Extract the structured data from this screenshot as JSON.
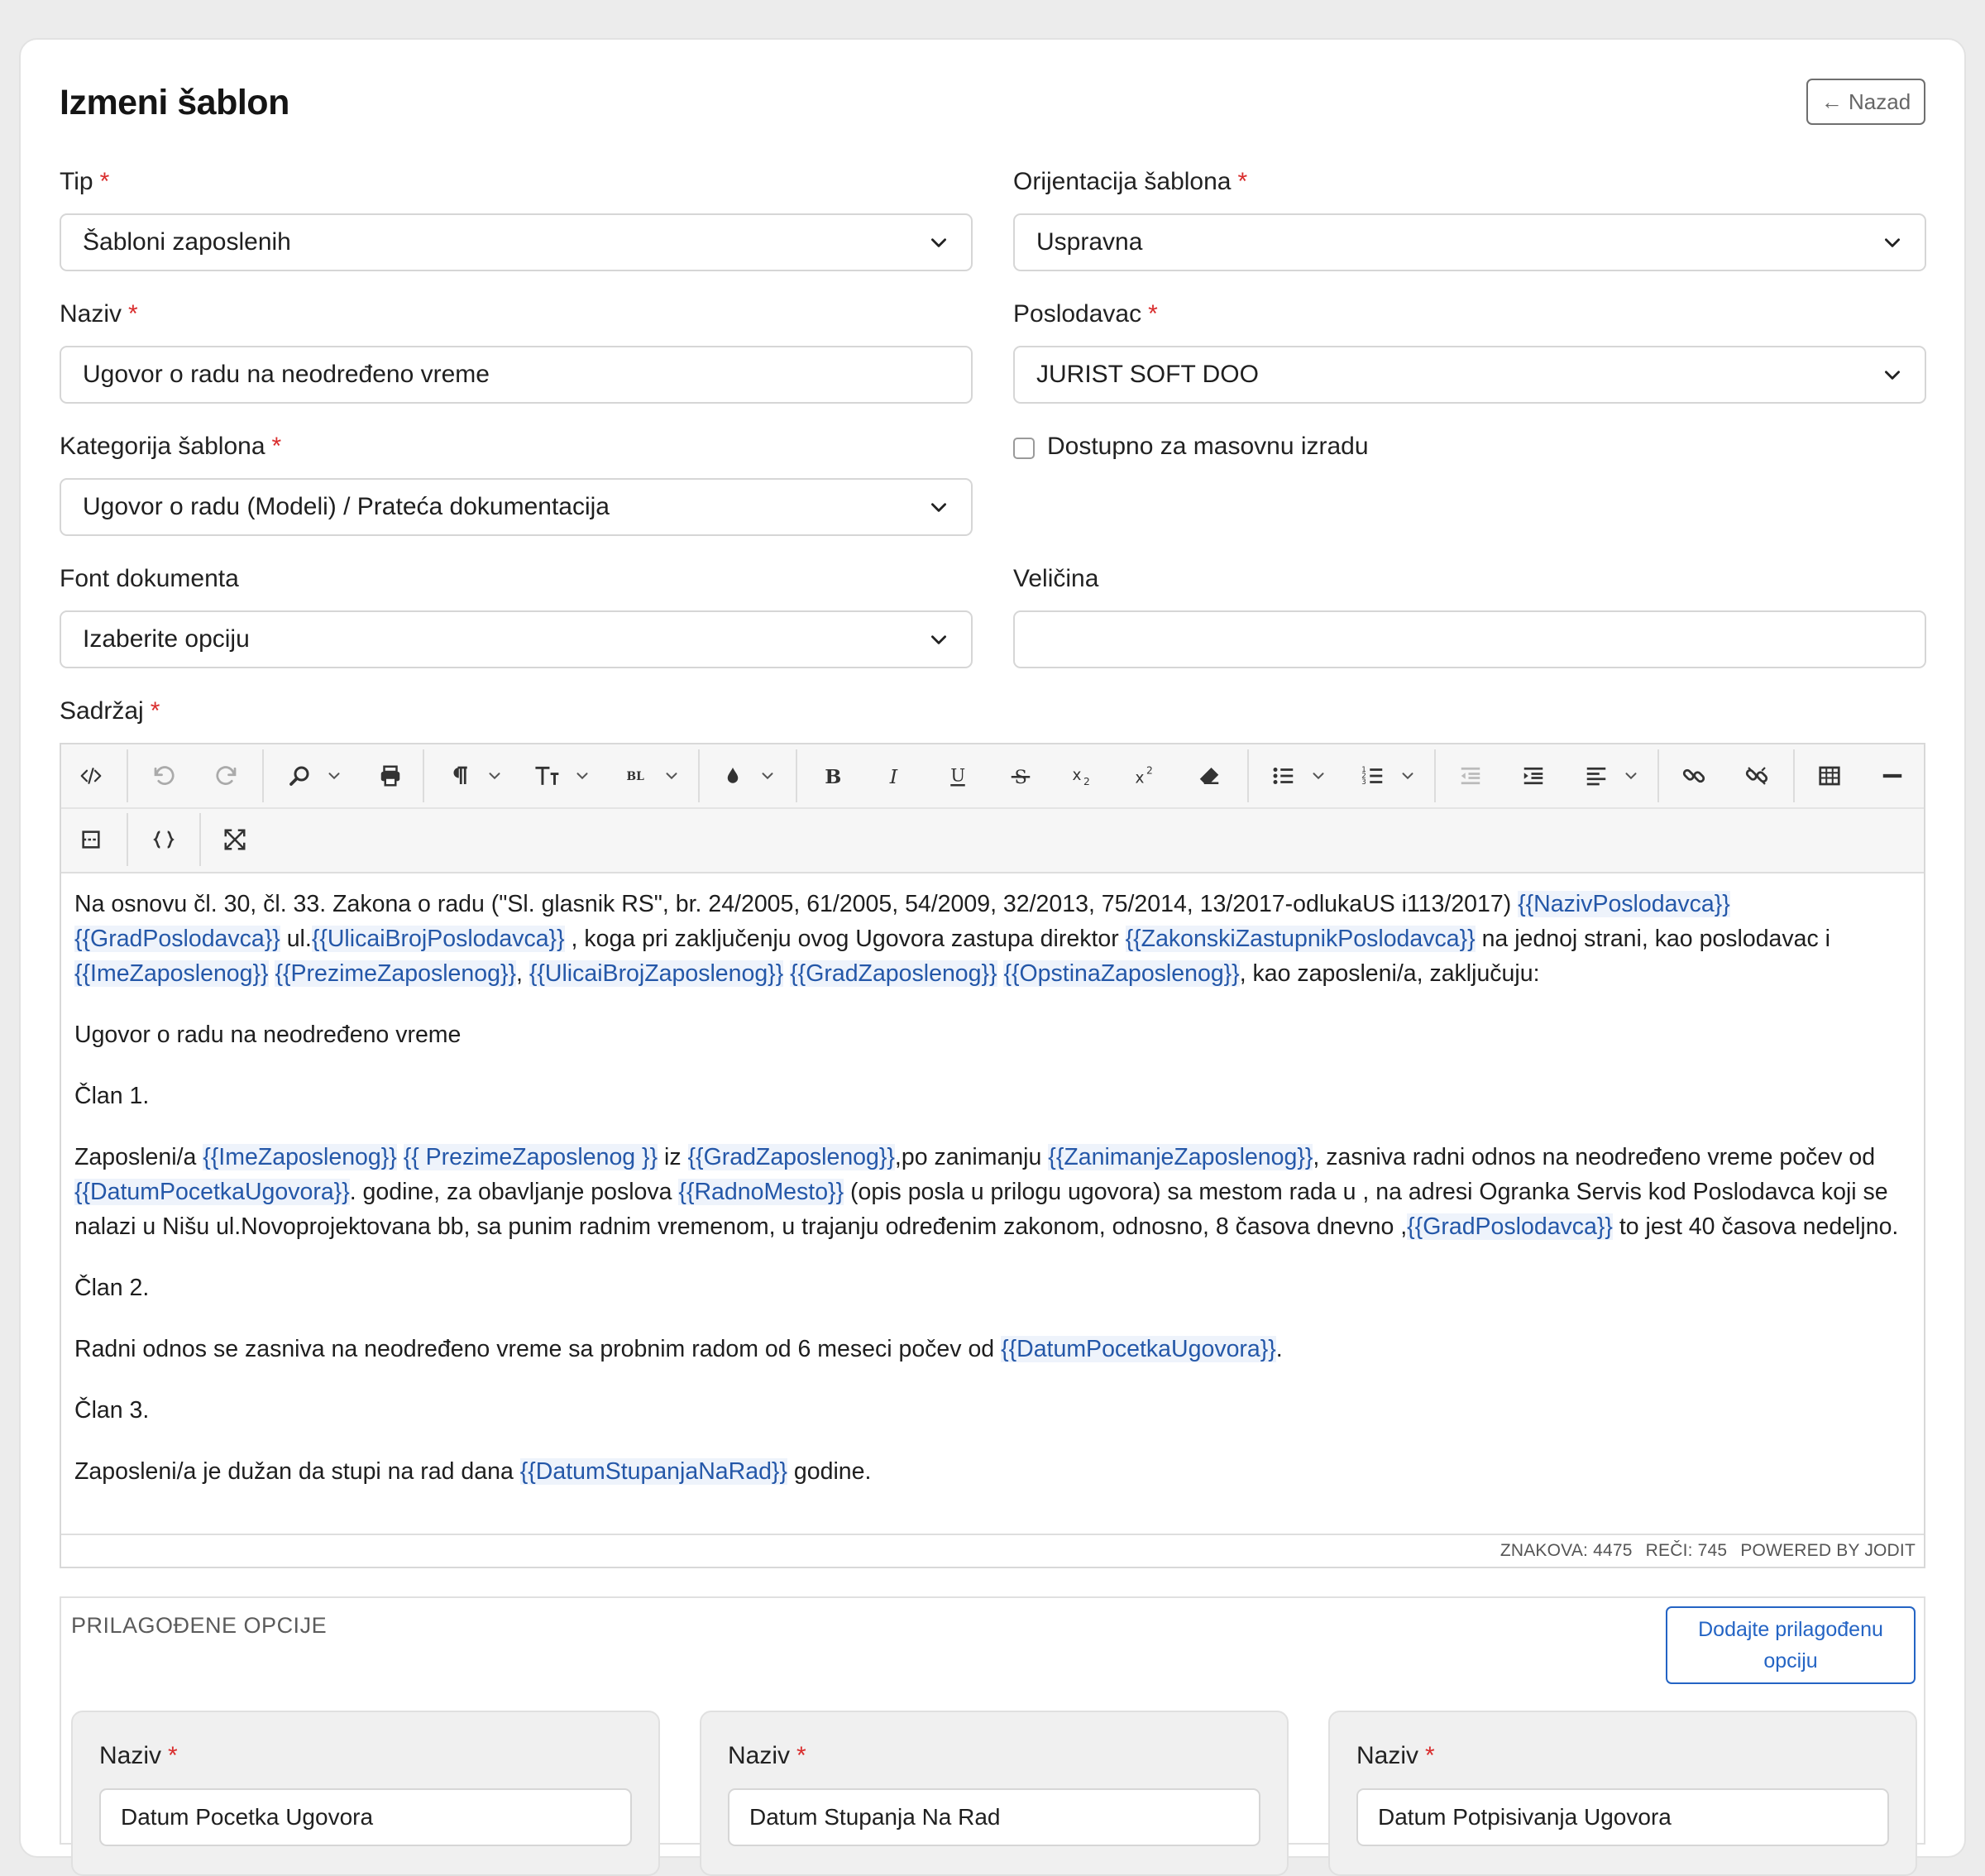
{
  "page": {
    "title": "Izmeni šablon",
    "back_label": "← Nazad"
  },
  "form": {
    "tip": {
      "label": "Tip",
      "value": "Šabloni zaposlenih"
    },
    "orijentacija": {
      "label": "Orijentacija šablona",
      "value": "Uspravna"
    },
    "naziv": {
      "label": "Naziv",
      "value": "Ugovor o radu na neodređeno vreme"
    },
    "poslodavac": {
      "label": "Poslodavac",
      "value": "JURIST SOFT DOO"
    },
    "kategorija": {
      "label": "Kategorija šablona",
      "value": "Ugovor o radu (Modeli) / Prateća dokumentacija"
    },
    "masovna": {
      "label": "Dostupno za masovnu izradu",
      "checked": false
    },
    "font": {
      "label": "Font dokumenta",
      "value": "Izaberite opciju"
    },
    "velicina": {
      "label": "Veličina",
      "value": ""
    },
    "sadrzaj_label": "Sadržaj",
    "required_mark": "*"
  },
  "editor": {
    "p1_a": "Na osnovu čl. 30, čl. 33.  Zakona o radu (\"Sl. glasnik RS\", br. 24/2005, 61/2005, 54/2009, 32/2013, 75/2014, 13/2017-odlukaUS i113/2017) ",
    "v_naziv_poslodavca": "{{NazivPoslodavca}}",
    "v_grad_poslodavca": "{{GradPoslodavca}}",
    "p1_ul": " ul.",
    "v_ulica_poslodavca": "{{UlicaiBrojPoslodavca}}",
    "p1_b": " , koga pri zaključenju ovog Ugovora zastupa direktor ",
    "v_zastupnik": "{{ZakonskiZastupnikPoslodavca}}",
    "p1_c": " na jednoj strani, kao poslodavac i ",
    "v_ime": "{{ImeZaposlenog}}",
    "v_prezime": "{{PrezimeZaposlenog}}",
    "v_ulica_zap": "{{UlicaiBrojZaposlenog}}",
    "v_grad_zap": "{{GradZaposlenog}}",
    "v_opstina_zap": "{{OpstinaZaposlenog}}",
    "p1_d": ", kao zaposleni/a, zaključuju:",
    "p2": "Ugovor o radu na neodređeno vreme",
    "p3": "Član 1.",
    "p4_a": "Zaposleni/a ",
    "v_prezime_sp": "{{ PrezimeZaposlenog }}",
    "p4_iz": " iz ",
    "p4_b": ",po zanimanju ",
    "v_zanimanje": "{{ZanimanjeZaposlenog}}",
    "p4_c": ",  zasniva radni odnos na neodređeno vreme počev od ",
    "v_datum_pocetka": "{{DatumPocetkaUgovora}}",
    "p4_d": ". godine, za obavljanje poslova ",
    "v_radno_mesto": "{{RadnoMesto}}",
    "p4_e": "  (opis posla u prilogu ugovora) sa mestom rada u , na adresi Ogranka Servis kod Poslodavca koji se nalazi u Nišu ul.Novoprojektovana bb, sa punim radnim vremenom, u trajanju određenim zakonom, odnosno, 8 časova dnevno ,",
    "p4_f": " to jest 40 časova nedeljno.",
    "p5": "Član 2.",
    "p6_a": "Radni odnos se zasniva na neodređeno vreme sa probnim radom od 6 meseci počev od ",
    "p6_b": ".",
    "p7": "Član 3.",
    "p8_a": "Zaposleni/a je dužan da stupi na rad dana ",
    "v_datum_stupanja": "{{DatumStupanjaNaRad}}",
    "p8_b": " godine.",
    "status_chars": "ZNAKOVA: 4475",
    "status_words": "REČI: 745",
    "status_powered": "POWERED BY JODIT"
  },
  "custom_options": {
    "title": "PRILAGOĐENE OPCIJE",
    "add_label": "Dodajte prilagođenu opciju",
    "items": [
      {
        "label": "Naziv",
        "value": "Datum Pocetka Ugovora"
      },
      {
        "label": "Naziv",
        "value": "Datum Stupanja Na Rad"
      },
      {
        "label": "Naziv",
        "value": "Datum Potpisivanja Ugovora"
      }
    ]
  },
  "colors": {
    "accent": "#2464c4",
    "required": "#d92d2d",
    "variable_text": "#2457a8",
    "variable_bg": "#eef3fb"
  }
}
